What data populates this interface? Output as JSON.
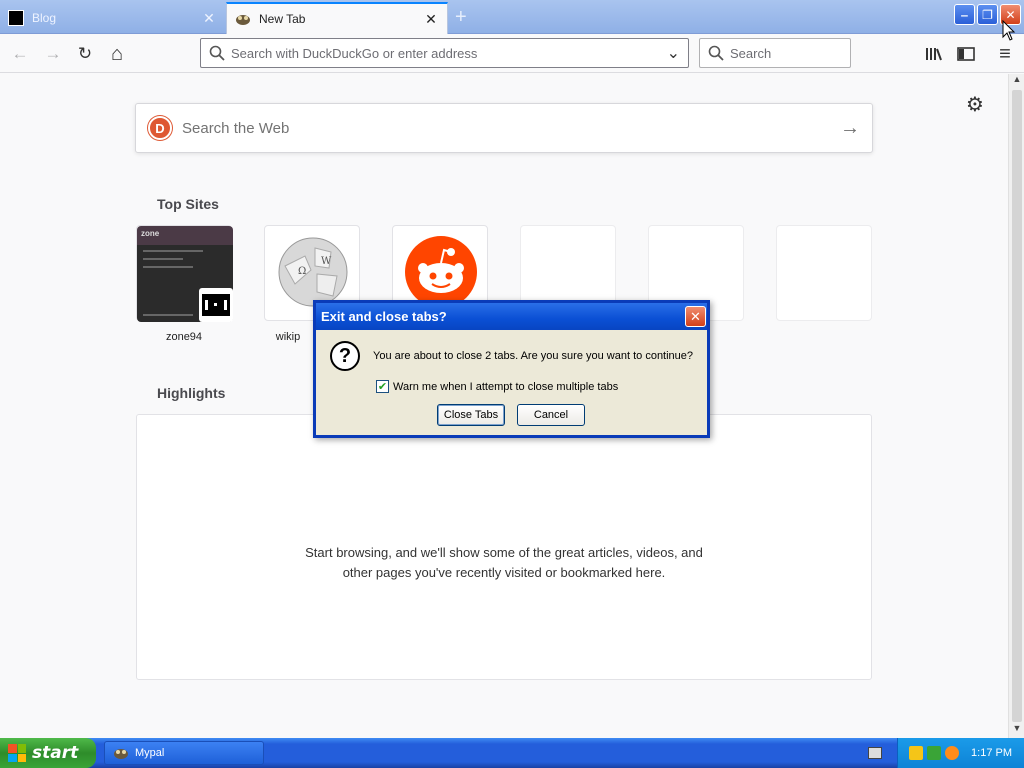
{
  "tabs": [
    {
      "title": "Blog",
      "close": "✕"
    },
    {
      "title": "New Tab",
      "close": "✕"
    }
  ],
  "new_tab_symbol": "+",
  "window_controls": {
    "minimize": "‒",
    "maximize": "❐",
    "close": "✕"
  },
  "nav": {
    "back_icon": "←",
    "forward_icon": "→",
    "reload_icon": "↻",
    "home_icon": "⌂",
    "url_placeholder": "Search with DuckDuckGo or enter address",
    "dropdown_icon": "⌄",
    "search_placeholder": "Search",
    "search_icon": "⚲",
    "library_icon": "|||\\",
    "sidebar_icon": "▤",
    "menu_icon": "≡"
  },
  "newtab": {
    "settings_icon": "⚙",
    "websearch_placeholder": "Search the Web",
    "websearch_arrow": "→",
    "ddg_logo_letter": "D",
    "topsites_title": "Top Sites",
    "topsites": [
      {
        "label": "zone94"
      },
      {
        "label": "wikip"
      },
      {
        "label": ""
      },
      {
        "label": ""
      },
      {
        "label": ""
      },
      {
        "label": ""
      }
    ],
    "highlights_title": "Highlights",
    "highlights_message": "Start browsing, and we'll show some of the great articles, videos, and other pages you've recently visited or bookmarked here."
  },
  "dialog": {
    "title": "Exit and close tabs?",
    "close": "✕",
    "icon": "?",
    "message": "You are about to close 2 tabs. Are you sure you want to continue?",
    "checkbox_label": "Warn me when I attempt to close multiple tabs",
    "checkbox_checked": true,
    "check_mark": "✔",
    "confirm_label": "Close Tabs",
    "cancel_label": "Cancel"
  },
  "taskbar": {
    "start_label": "start",
    "task_label": "Mypal",
    "clock": "1:17 PM"
  },
  "colors": {
    "accent": "#0a84ff",
    "dialog_title": "#0a4fd4",
    "reddit": "#ff4500",
    "ddg": "#de5833"
  }
}
